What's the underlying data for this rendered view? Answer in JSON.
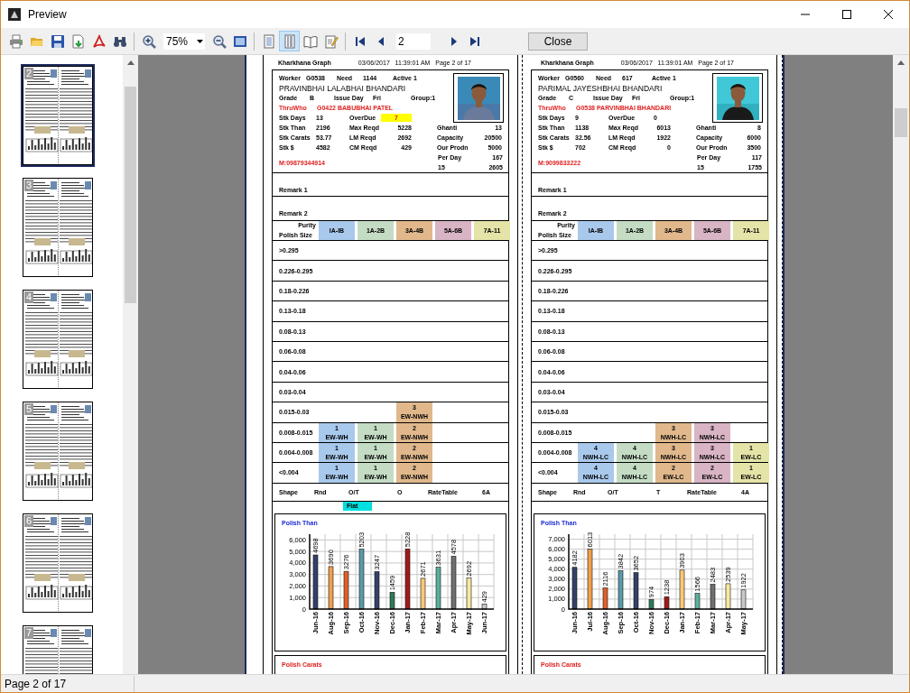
{
  "window": {
    "title": "Preview"
  },
  "toolbar": {
    "zoom": "75%",
    "page_field": "2",
    "close_button": "Close",
    "view_buttons": [
      {
        "selected": false
      },
      {
        "selected": true
      },
      {
        "selected": false
      }
    ]
  },
  "thumbnails": [
    {
      "page": "2",
      "selected": true
    },
    {
      "page": "3",
      "selected": false
    },
    {
      "page": "4",
      "selected": false
    },
    {
      "page": "5",
      "selected": false
    },
    {
      "page": "6",
      "selected": false
    },
    {
      "page": "7",
      "selected": false
    }
  ],
  "cards": [
    {
      "report_title": "Kharkhana Graph",
      "report_stamp": "03/06/2017   11:39:01 AM   Page 2 of 17",
      "worker_line": [
        "Worker",
        "G0538",
        "Need",
        "1144",
        "Active 1"
      ],
      "name": "PRAVINBHAI LALABHAI BHANDARI",
      "grade_line": [
        "Grade",
        "B",
        "Issue Day",
        "Fri",
        "Group:1"
      ],
      "thru_line": [
        "ThruWho",
        "G0422  BABUBHAI PATEL"
      ],
      "stats": [
        {
          "cells": [
            [
              "Stk Days",
              "13"
            ],
            [
              "OverDue",
              "7"
            ]
          ]
        },
        {
          "cells": [
            [
              "Stk Than",
              "2196"
            ],
            [
              "Max Reqd",
              "5228"
            ],
            [
              "Ghanti",
              "13"
            ]
          ]
        },
        {
          "cells": [
            [
              "Stk Carats",
              "53.77"
            ],
            [
              "LM Reqd",
              "2692"
            ],
            [
              "Capacity",
              "20500"
            ]
          ]
        },
        {
          "cells": [
            [
              "Stk $",
              "4582"
            ],
            [
              "CM Reqd",
              "429"
            ],
            [
              "Our Prodn",
              "5000"
            ]
          ]
        }
      ],
      "overdue_alert": true,
      "mobile": "M:09879344914",
      "per_day": [
        "Per Day",
        "167"
      ],
      "totals": [
        "15",
        "2605"
      ],
      "remarks": [
        "Remark 1",
        "Remark 2"
      ],
      "purity_label": "Purity",
      "size_label": "Polish Size",
      "grades": [
        {
          "label": "IA-IB",
          "color": "#a9c9ec"
        },
        {
          "label": "1A-2B",
          "color": "#c4dcc4"
        },
        {
          "label": "3A-4B",
          "color": "#e0b88c"
        },
        {
          "label": "5A-6B",
          "color": "#d8b4c4"
        },
        {
          "label": "7A-11",
          "color": "#e4e4a8"
        }
      ],
      "rows": [
        {
          "size": ">0.295"
        },
        {
          "size": "0.226-0.295"
        },
        {
          "size": "0.18-0.226"
        },
        {
          "size": "0.13-0.18"
        },
        {
          "size": "0.08-0.13"
        },
        {
          "size": "0.06-0.08"
        },
        {
          "size": "0.04-0.06"
        },
        {
          "size": "0.03-0.04"
        },
        {
          "size": "0.015-0.03",
          "cells": [
            {
              "filled": false
            },
            {
              "filled": false
            },
            {
              "filled": true,
              "count": "3",
              "code": "EW-NWH"
            },
            {
              "filled": false
            },
            {
              "filled": false
            }
          ]
        },
        {
          "size": "0.008-0.015",
          "cells": [
            {
              "filled": true,
              "count": "1",
              "code": "EW-WH"
            },
            {
              "filled": true,
              "count": "1",
              "code": "EW-WH"
            },
            {
              "filled": true,
              "count": "2",
              "code": "EW-NWH"
            },
            {
              "filled": false
            },
            {
              "filled": false
            }
          ]
        },
        {
          "size": "0.004-0.008",
          "cells": [
            {
              "filled": true,
              "count": "1",
              "code": "EW-WH"
            },
            {
              "filled": true,
              "count": "1",
              "code": "EW-WH"
            },
            {
              "filled": true,
              "count": "2",
              "code": "EW-NWH"
            },
            {
              "filled": false
            },
            {
              "filled": false
            }
          ]
        },
        {
          "size": "<0.004",
          "cells": [
            {
              "filled": true,
              "count": "1",
              "code": "EW-WH"
            },
            {
              "filled": true,
              "count": "1",
              "code": "EW-WH"
            },
            {
              "filled": true,
              "count": "2",
              "code": "EW-NWH"
            },
            {
              "filled": false
            },
            {
              "filled": false
            }
          ]
        }
      ],
      "shape_line": [
        "Shape",
        "Rnd",
        "O/T",
        "O",
        "RateTable",
        "6A"
      ],
      "flat_tag": "Flat",
      "chart_data": {
        "type": "bar",
        "title": "Polish Than",
        "categories": [
          "Jun-16",
          "Aug-16",
          "Sep-16",
          "Oct-16",
          "Nov-16",
          "Dec-16",
          "Jan-17",
          "Feb-17",
          "Mar-17",
          "Apr-17",
          "May-17",
          "Jun-17"
        ],
        "series": [
          {
            "values": [
              4698,
              3690,
              3276,
              5203,
              3247,
              1459,
              5228,
              2671,
              3631,
              4578,
              2692,
              429
            ]
          }
        ],
        "grid": true,
        "ylim": [
          0,
          6500
        ],
        "yticks": [
          {
            "value": 0,
            "label": "0"
          },
          {
            "value": 1000,
            "label": "1,000"
          },
          {
            "value": 2000,
            "label": "2,000"
          },
          {
            "value": 3000,
            "label": "3,000"
          },
          {
            "value": 4000,
            "label": "4,000"
          },
          {
            "value": 5000,
            "label": "5,000"
          },
          {
            "value": 6000,
            "label": "6,000"
          }
        ],
        "data_labels": true
      },
      "carats_title": "Polish Carats"
    },
    {
      "report_title": "Kharkhana Graph",
      "report_stamp": "03/06/2017   11:39:01 AM   Page 2 of 17",
      "worker_line": [
        "Worker",
        "G0560",
        "Need",
        "617",
        "Active 1"
      ],
      "name": "PARIMAL JAYESHBHAI BHANDARI",
      "grade_line": [
        "Grade",
        "C",
        "Issue Day",
        "Fri",
        "Group:1"
      ],
      "thru_line": [
        "ThruWho",
        "G0538  PARVINBHAI BHANDARI"
      ],
      "stats": [
        {
          "cells": [
            [
              "Stk Days",
              "9"
            ],
            [
              "OverDue",
              "0"
            ]
          ]
        },
        {
          "cells": [
            [
              "Stk Than",
              "1138"
            ],
            [
              "Max Reqd",
              "6013"
            ],
            [
              "Ghanti",
              "8"
            ]
          ]
        },
        {
          "cells": [
            [
              "Stk Carats",
              "32.56"
            ],
            [
              "LM Reqd",
              "1922"
            ],
            [
              "Capacity",
              "6000"
            ]
          ]
        },
        {
          "cells": [
            [
              "Stk $",
              "702"
            ],
            [
              "CM Reqd",
              "0"
            ],
            [
              "Our Prodn",
              "3500"
            ]
          ]
        }
      ],
      "overdue_alert": false,
      "mobile": "M:9099833222",
      "per_day": [
        "Per Day",
        "117"
      ],
      "totals": [
        "15",
        "1755"
      ],
      "remarks": [
        "Remark 1",
        "Remark 2"
      ],
      "purity_label": "Purity",
      "size_label": "Polish Size",
      "grades": [
        {
          "label": "IA-IB",
          "color": "#a9c9ec"
        },
        {
          "label": "1A-2B",
          "color": "#c4dcc4"
        },
        {
          "label": "3A-4B",
          "color": "#e0b88c"
        },
        {
          "label": "5A-6B",
          "color": "#d8b4c4"
        },
        {
          "label": "7A-11",
          "color": "#e4e4a8"
        }
      ],
      "rows": [
        {
          "size": ">0.295"
        },
        {
          "size": "0.226-0.295"
        },
        {
          "size": "0.18-0.226"
        },
        {
          "size": "0.13-0.18"
        },
        {
          "size": "0.08-0.13"
        },
        {
          "size": "0.06-0.08"
        },
        {
          "size": "0.04-0.06"
        },
        {
          "size": "0.03-0.04"
        },
        {
          "size": "0.015-0.03"
        },
        {
          "size": "0.008-0.015",
          "cells": [
            {
              "filled": false
            },
            {
              "filled": false
            },
            {
              "filled": true,
              "count": "3",
              "code": "NWH-LC"
            },
            {
              "filled": true,
              "count": "3",
              "code": "NWH-LC"
            },
            {
              "filled": false
            }
          ]
        },
        {
          "size": "0.004-0.008",
          "cells": [
            {
              "filled": true,
              "count": "4",
              "code": "NWH-LC"
            },
            {
              "filled": true,
              "count": "4",
              "code": "NWH-LC"
            },
            {
              "filled": true,
              "count": "3",
              "code": "NWH-LC"
            },
            {
              "filled": true,
              "count": "3",
              "code": "NWH-LC"
            },
            {
              "filled": true,
              "count": "1",
              "code": "EW-LC"
            }
          ]
        },
        {
          "size": "<0.004",
          "cells": [
            {
              "filled": true,
              "count": "4",
              "code": "NWH-LC"
            },
            {
              "filled": true,
              "count": "4",
              "code": "NWH-LC"
            },
            {
              "filled": true,
              "count": "2",
              "code": "EW-LC"
            },
            {
              "filled": true,
              "count": "2",
              "code": "EW-LC"
            },
            {
              "filled": true,
              "count": "1",
              "code": "EW-LC"
            }
          ]
        }
      ],
      "shape_line": [
        "Shape",
        "Rnd",
        "O/T",
        "T",
        "RateTable",
        "4A"
      ],
      "chart_data": {
        "type": "bar",
        "title": "Polish Than",
        "categories": [
          "Jun-16",
          "Jul-16",
          "Aug-16",
          "Sep-16",
          "Oct-16",
          "Nov-16",
          "Dec-16",
          "Jan-17",
          "Feb-17",
          "Mar-17",
          "Apr-17",
          "May-17"
        ],
        "series": [
          {
            "values": [
              4182,
              6013,
              2116,
              3842,
              3652,
              974,
              1238,
              3903,
              1566,
              2483,
              2539,
              1922
            ]
          }
        ],
        "grid": true,
        "ylim": [
          0,
          7500
        ],
        "yticks": [
          {
            "value": 0,
            "label": "0"
          },
          {
            "value": 1000,
            "label": "1,000"
          },
          {
            "value": 2000,
            "label": "2,000"
          },
          {
            "value": 3000,
            "label": "3,000"
          },
          {
            "value": 4000,
            "label": "4,000"
          },
          {
            "value": 5000,
            "label": "5,000"
          },
          {
            "value": 6000,
            "label": "6,000"
          },
          {
            "value": 7000,
            "label": "7,000"
          }
        ],
        "data_labels": true
      },
      "carats_title": "Polish Carats"
    }
  ],
  "status_bar": "Page 2 of 17"
}
